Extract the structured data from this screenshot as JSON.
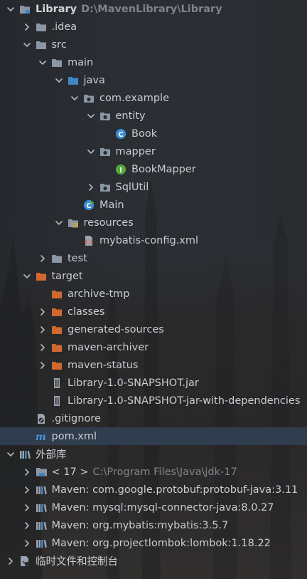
{
  "project": {
    "name": "Library",
    "path": "D:\\MavenLibrary\\Library"
  },
  "tree": [
    {
      "label": "Library",
      "suffix": "D:\\MavenLibrary\\Library",
      "icon": "folder-module-icon",
      "arrow": "down",
      "level": 0
    },
    {
      "label": ".idea",
      "icon": "folder-icon",
      "arrow": "right",
      "level": 1
    },
    {
      "label": "src",
      "icon": "folder-icon",
      "arrow": "down",
      "level": 1
    },
    {
      "label": "main",
      "icon": "folder-icon",
      "arrow": "down",
      "level": 2
    },
    {
      "label": "java",
      "icon": "source-folder-icon",
      "arrow": "down",
      "level": 3
    },
    {
      "label": "com.example",
      "icon": "package-icon",
      "arrow": "down",
      "level": 4
    },
    {
      "label": "entity",
      "icon": "package-icon",
      "arrow": "down",
      "level": 5
    },
    {
      "label": "Book",
      "icon": "class-icon",
      "arrow": "none",
      "level": 6
    },
    {
      "label": "mapper",
      "icon": "package-icon",
      "arrow": "down",
      "level": 5
    },
    {
      "label": "BookMapper",
      "icon": "interface-icon",
      "arrow": "none",
      "level": 6
    },
    {
      "label": "SqlUtil",
      "icon": "package-icon",
      "arrow": "right",
      "level": 5
    },
    {
      "label": "Main",
      "icon": "main-class-icon",
      "arrow": "none",
      "level": 4
    },
    {
      "label": "resources",
      "icon": "resources-folder-icon",
      "arrow": "down",
      "level": 3
    },
    {
      "label": "mybatis-config.xml",
      "icon": "xml-file-icon",
      "arrow": "none",
      "level": 4
    },
    {
      "label": "test",
      "icon": "folder-icon",
      "arrow": "right",
      "level": 2
    },
    {
      "label": "target",
      "icon": "excluded-folder-icon",
      "arrow": "down",
      "level": 1
    },
    {
      "label": "archive-tmp",
      "icon": "excluded-folder-icon",
      "arrow": "none",
      "level": 2
    },
    {
      "label": "classes",
      "icon": "excluded-folder-icon",
      "arrow": "right",
      "level": 2
    },
    {
      "label": "generated-sources",
      "icon": "excluded-folder-icon",
      "arrow": "right",
      "level": 2
    },
    {
      "label": "maven-archiver",
      "icon": "excluded-folder-icon",
      "arrow": "right",
      "level": 2
    },
    {
      "label": "maven-status",
      "icon": "excluded-folder-icon",
      "arrow": "right",
      "level": 2
    },
    {
      "label": "Library-1.0-SNAPSHOT.jar",
      "icon": "jar-icon",
      "arrow": "none",
      "level": 2
    },
    {
      "label": "Library-1.0-SNAPSHOT-jar-with-dependencies",
      "icon": "jar-icon",
      "arrow": "none",
      "level": 2
    },
    {
      "label": ".gitignore",
      "icon": "gitignore-icon",
      "arrow": "none",
      "level": 1
    },
    {
      "label": "pom.xml",
      "icon": "maven-icon",
      "arrow": "none",
      "level": 1,
      "selected": true
    },
    {
      "label": "外部库",
      "icon": "library-icon",
      "arrow": "down",
      "level": 0
    },
    {
      "label": "< 17 >",
      "suffix": "C:\\Program Files\\Java\\jdk-17",
      "icon": "jdk-icon",
      "arrow": "right",
      "level": 1
    },
    {
      "label": "Maven: com.google.protobuf:protobuf-java:3.11",
      "icon": "library-icon",
      "arrow": "right",
      "level": 1
    },
    {
      "label": "Maven: mysql:mysql-connector-java:8.0.27",
      "icon": "library-icon",
      "arrow": "right",
      "level": 1
    },
    {
      "label": "Maven: org.mybatis:mybatis:3.5.7",
      "icon": "library-icon",
      "arrow": "right",
      "level": 1
    },
    {
      "label": "Maven: org.projectlombok:lombok:1.18.22",
      "icon": "library-icon",
      "arrow": "right",
      "level": 1
    },
    {
      "label": "临时文件和控制台",
      "icon": "scratches-icon",
      "arrow": "right",
      "level": 0
    }
  ],
  "colors": {
    "selected_row": "#2f3d4f",
    "folder": "#8a96a3",
    "source_folder": "#3e86c8",
    "excluded_folder": "#d1682f",
    "class": "#3b8fd6",
    "interface": "#55a83a"
  }
}
